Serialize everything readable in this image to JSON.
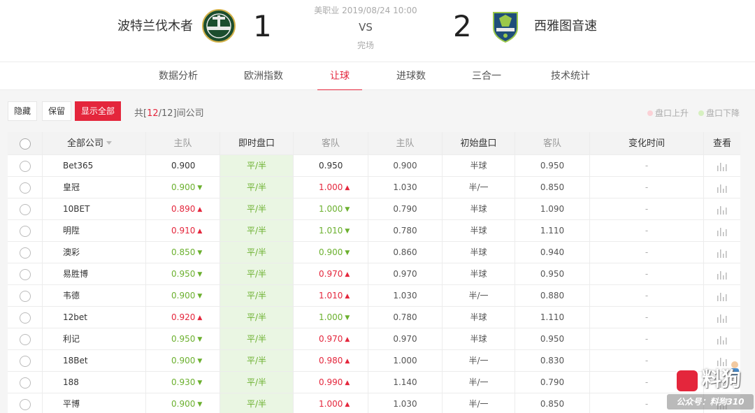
{
  "match": {
    "home_name": "波特兰伐木者",
    "home_score": "1",
    "away_name": "西雅图音速",
    "away_score": "2",
    "league_time": "美职业 2019/08/24 10:00",
    "vs": "VS",
    "status": "完场",
    "home_logo_icon": "portland-timbers-logo-icon",
    "away_logo_icon": "seattle-sounders-logo-icon"
  },
  "tabs": [
    {
      "label": "数据分析",
      "active": false
    },
    {
      "label": "欧洲指数",
      "active": false
    },
    {
      "label": "让球",
      "active": true
    },
    {
      "label": "进球数",
      "active": false
    },
    {
      "label": "三合一",
      "active": false
    },
    {
      "label": "技术统计",
      "active": false
    }
  ],
  "toolbar": {
    "hide_label": "隐藏",
    "keep_label": "保留",
    "show_all_label": "显示全部",
    "count_prefix": "共[",
    "count_shown": "12",
    "count_total": "/12]间公司",
    "legend_up": "盘口上升",
    "legend_down": "盘口下降"
  },
  "table": {
    "headers": {
      "company": "全部公司",
      "home": "主队",
      "live_line": "即时盘口",
      "away": "客队",
      "init_home": "主队",
      "init_line": "初始盘口",
      "init_away": "客队",
      "change_time": "变化时间",
      "view": "查看"
    },
    "rows": [
      {
        "company": "Bet365",
        "home": "0.900",
        "home_dir": "flat",
        "line": "平/半",
        "away": "0.950",
        "away_dir": "flat",
        "init_home": "0.900",
        "init_line": "半球",
        "init_away": "0.950",
        "time": "-"
      },
      {
        "company": "皇冠",
        "home": "0.900",
        "home_dir": "down",
        "line": "平/半",
        "away": "1.000",
        "away_dir": "up",
        "init_home": "1.030",
        "init_line": "半/一",
        "init_away": "0.850",
        "time": "-"
      },
      {
        "company": "10BET",
        "home": "0.890",
        "home_dir": "up",
        "line": "平/半",
        "away": "1.000",
        "away_dir": "down",
        "init_home": "0.790",
        "init_line": "半球",
        "init_away": "1.090",
        "time": "-"
      },
      {
        "company": "明陞",
        "home": "0.910",
        "home_dir": "up",
        "line": "平/半",
        "away": "1.010",
        "away_dir": "down",
        "init_home": "0.780",
        "init_line": "半球",
        "init_away": "1.110",
        "time": "-"
      },
      {
        "company": "澳彩",
        "home": "0.850",
        "home_dir": "down",
        "line": "平/半",
        "away": "0.900",
        "away_dir": "down",
        "init_home": "0.860",
        "init_line": "半球",
        "init_away": "0.940",
        "time": "-"
      },
      {
        "company": "易胜博",
        "home": "0.950",
        "home_dir": "down",
        "line": "平/半",
        "away": "0.970",
        "away_dir": "up",
        "init_home": "0.970",
        "init_line": "半球",
        "init_away": "0.950",
        "time": "-"
      },
      {
        "company": "韦德",
        "home": "0.900",
        "home_dir": "down",
        "line": "平/半",
        "away": "1.010",
        "away_dir": "up",
        "init_home": "1.030",
        "init_line": "半/一",
        "init_away": "0.880",
        "time": "-"
      },
      {
        "company": "12bet",
        "home": "0.920",
        "home_dir": "up",
        "line": "平/半",
        "away": "1.000",
        "away_dir": "down",
        "init_home": "0.780",
        "init_line": "半球",
        "init_away": "1.110",
        "time": "-"
      },
      {
        "company": "利记",
        "home": "0.950",
        "home_dir": "down",
        "line": "平/半",
        "away": "0.970",
        "away_dir": "up",
        "init_home": "0.970",
        "init_line": "半球",
        "init_away": "0.950",
        "time": "-"
      },
      {
        "company": "18Bet",
        "home": "0.900",
        "home_dir": "down",
        "line": "平/半",
        "away": "0.980",
        "away_dir": "up",
        "init_home": "1.000",
        "init_line": "半/一",
        "init_away": "0.830",
        "time": "-"
      },
      {
        "company": "188",
        "home": "0.930",
        "home_dir": "down",
        "line": "平/半",
        "away": "0.990",
        "away_dir": "up",
        "init_home": "1.140",
        "init_line": "半/一",
        "init_away": "0.790",
        "time": "-"
      },
      {
        "company": "平博",
        "home": "0.900",
        "home_dir": "down",
        "line": "平/半",
        "away": "1.000",
        "away_dir": "up",
        "init_home": "1.030",
        "init_line": "半/一",
        "init_away": "0.850",
        "time": "-"
      }
    ]
  },
  "watermark": {
    "title": "料狗",
    "subtitle": "公众号：料狗310"
  },
  "colors": {
    "accent": "#e4263c",
    "down": "#6bb02e",
    "live_bg": "#eaf6e3"
  }
}
